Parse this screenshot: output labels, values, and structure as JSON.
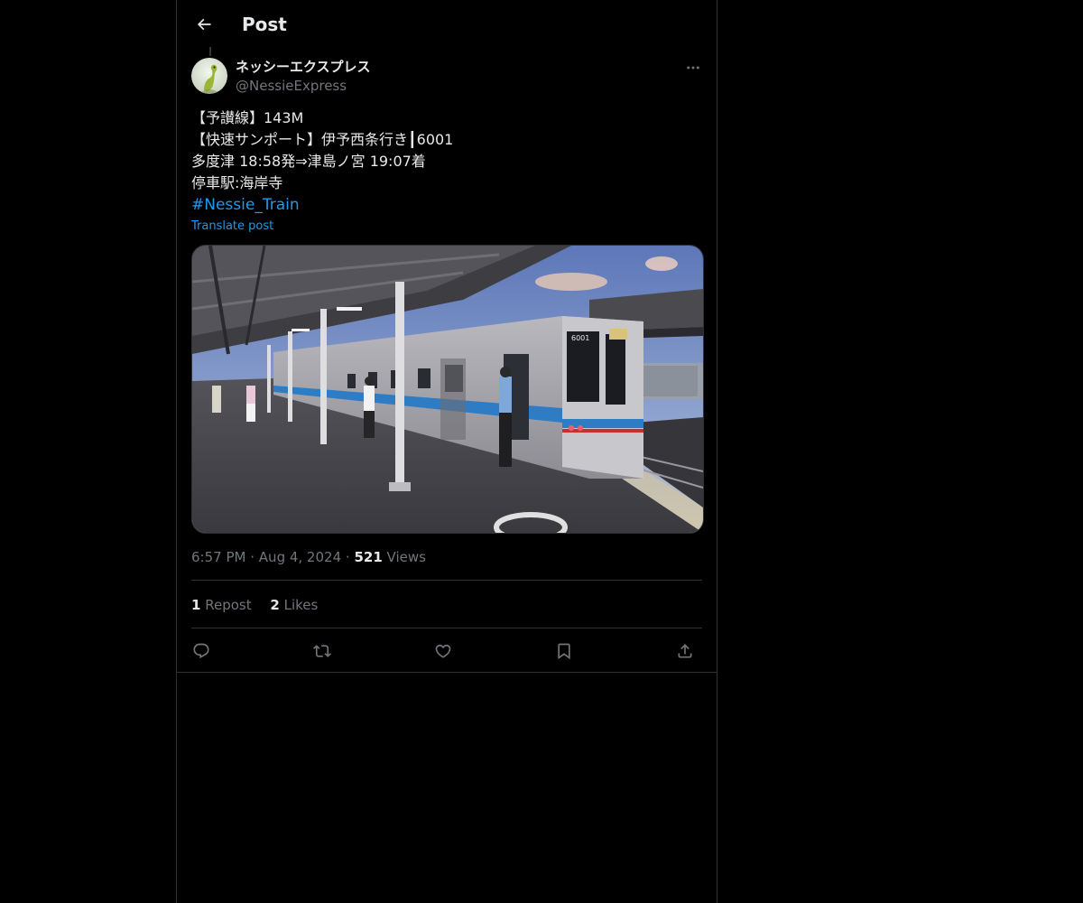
{
  "header": {
    "title": "Post",
    "back_icon": "arrow-left-icon"
  },
  "author": {
    "display_name": "ネッシーエクスプレス",
    "handle": "@NessieExpress",
    "avatar_icon": "nessie-avatar"
  },
  "post": {
    "lines": [
      "【予讃線】143M",
      "【快速サンポート】伊予西条行き┃6001",
      "多度津 18:58発⇒津島ノ宮 19:07着",
      "停車駅:海岸寺"
    ],
    "hashtag": "#Nessie_Train",
    "translate_label": "Translate post",
    "media_description_icon": "train-photo"
  },
  "meta": {
    "time": "6:57 PM",
    "separator": "·",
    "date": "Aug 4, 2024",
    "views_count": "521",
    "views_label": "Views"
  },
  "stats": {
    "reposts_count": "1",
    "reposts_label": "Repost",
    "likes_count": "2",
    "likes_label": "Likes"
  },
  "actions": [
    {
      "name": "reply",
      "icon": "reply-icon"
    },
    {
      "name": "repost",
      "icon": "repost-icon"
    },
    {
      "name": "like",
      "icon": "heart-icon"
    },
    {
      "name": "bookmark",
      "icon": "bookmark-icon"
    },
    {
      "name": "share",
      "icon": "share-icon"
    }
  ],
  "colors": {
    "background": "#000000",
    "text_primary": "#e7e9ea",
    "text_secondary": "#71767b",
    "link": "#1d9bf0",
    "border": "#2f3336"
  }
}
